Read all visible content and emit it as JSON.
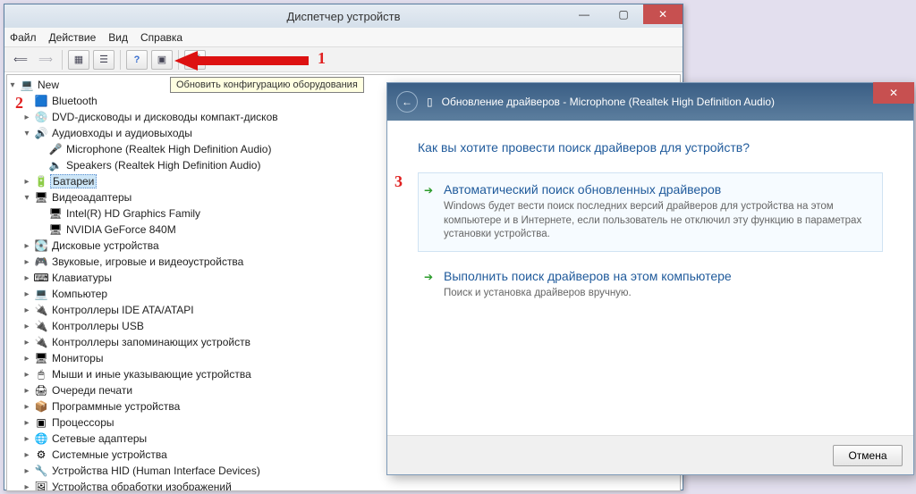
{
  "dm": {
    "title": "Диспетчер устройств",
    "menu": [
      "Файл",
      "Действие",
      "Вид",
      "Справка"
    ],
    "tooltip": "Обновить конфигурацию оборудования",
    "root": "New",
    "nodes": [
      {
        "exp": "",
        "ind": 1,
        "icon": "🟦",
        "label": "Bluetooth"
      },
      {
        "exp": "▸",
        "ind": 1,
        "icon": "💿",
        "label": "DVD-дисководы и дисководы компакт-дисков"
      },
      {
        "exp": "▾",
        "ind": 1,
        "icon": "🔊",
        "label": "Аудиовходы и аудиовыходы"
      },
      {
        "exp": "",
        "ind": 2,
        "icon": "🎤",
        "label": "Microphone (Realtek High Definition Audio)"
      },
      {
        "exp": "",
        "ind": 2,
        "icon": "🔈",
        "label": "Speakers (Realtek High Definition Audio)"
      },
      {
        "exp": "▸",
        "ind": 1,
        "icon": "🔋",
        "label": "Батареи",
        "sel": true
      },
      {
        "exp": "▾",
        "ind": 1,
        "icon": "🖥",
        "label": "Видеоадаптеры"
      },
      {
        "exp": "",
        "ind": 2,
        "icon": "🖥",
        "label": "Intel(R) HD Graphics Family"
      },
      {
        "exp": "",
        "ind": 2,
        "icon": "🖥",
        "label": "NVIDIA GeForce 840M"
      },
      {
        "exp": "▸",
        "ind": 1,
        "icon": "💽",
        "label": "Дисковые устройства"
      },
      {
        "exp": "▸",
        "ind": 1,
        "icon": "🎮",
        "label": "Звуковые, игровые и видеоустройства"
      },
      {
        "exp": "▸",
        "ind": 1,
        "icon": "⌨",
        "label": "Клавиатуры"
      },
      {
        "exp": "▸",
        "ind": 1,
        "icon": "💻",
        "label": "Компьютер"
      },
      {
        "exp": "▸",
        "ind": 1,
        "icon": "🔌",
        "label": "Контроллеры IDE ATA/ATAPI"
      },
      {
        "exp": "▸",
        "ind": 1,
        "icon": "🔌",
        "label": "Контроллеры USB"
      },
      {
        "exp": "▸",
        "ind": 1,
        "icon": "🔌",
        "label": "Контроллеры запоминающих устройств"
      },
      {
        "exp": "▸",
        "ind": 1,
        "icon": "🖥",
        "label": "Мониторы"
      },
      {
        "exp": "▸",
        "ind": 1,
        "icon": "🖱",
        "label": "Мыши и иные указывающие устройства"
      },
      {
        "exp": "▸",
        "ind": 1,
        "icon": "🖨",
        "label": "Очереди печати"
      },
      {
        "exp": "▸",
        "ind": 1,
        "icon": "📦",
        "label": "Программные устройства"
      },
      {
        "exp": "▸",
        "ind": 1,
        "icon": "▣",
        "label": "Процессоры"
      },
      {
        "exp": "▸",
        "ind": 1,
        "icon": "🌐",
        "label": "Сетевые адаптеры"
      },
      {
        "exp": "▸",
        "ind": 1,
        "icon": "⚙",
        "label": "Системные устройства"
      },
      {
        "exp": "▸",
        "ind": 1,
        "icon": "🔧",
        "label": "Устройства HID (Human Interface Devices)"
      },
      {
        "exp": "▸",
        "ind": 1,
        "icon": "🖼",
        "label": "Устройства обработки изображений"
      }
    ]
  },
  "wizard": {
    "title": "Обновление драйверов - Microphone (Realtek High Definition Audio)",
    "question": "Как вы хотите провести поиск драйверов для устройств?",
    "opt1_title": "Автоматический поиск обновленных драйверов",
    "opt1_desc": "Windows будет вести поиск последних версий драйверов для устройства на этом компьютере и в Интернете, если пользователь не отключил эту функцию в параметрах установки устройства.",
    "opt2_title": "Выполнить поиск драйверов на этом компьютере",
    "opt2_desc": "Поиск и установка драйверов вручную.",
    "cancel": "Отмена"
  },
  "ann": {
    "a1": "1",
    "a2": "2",
    "a3": "3"
  }
}
